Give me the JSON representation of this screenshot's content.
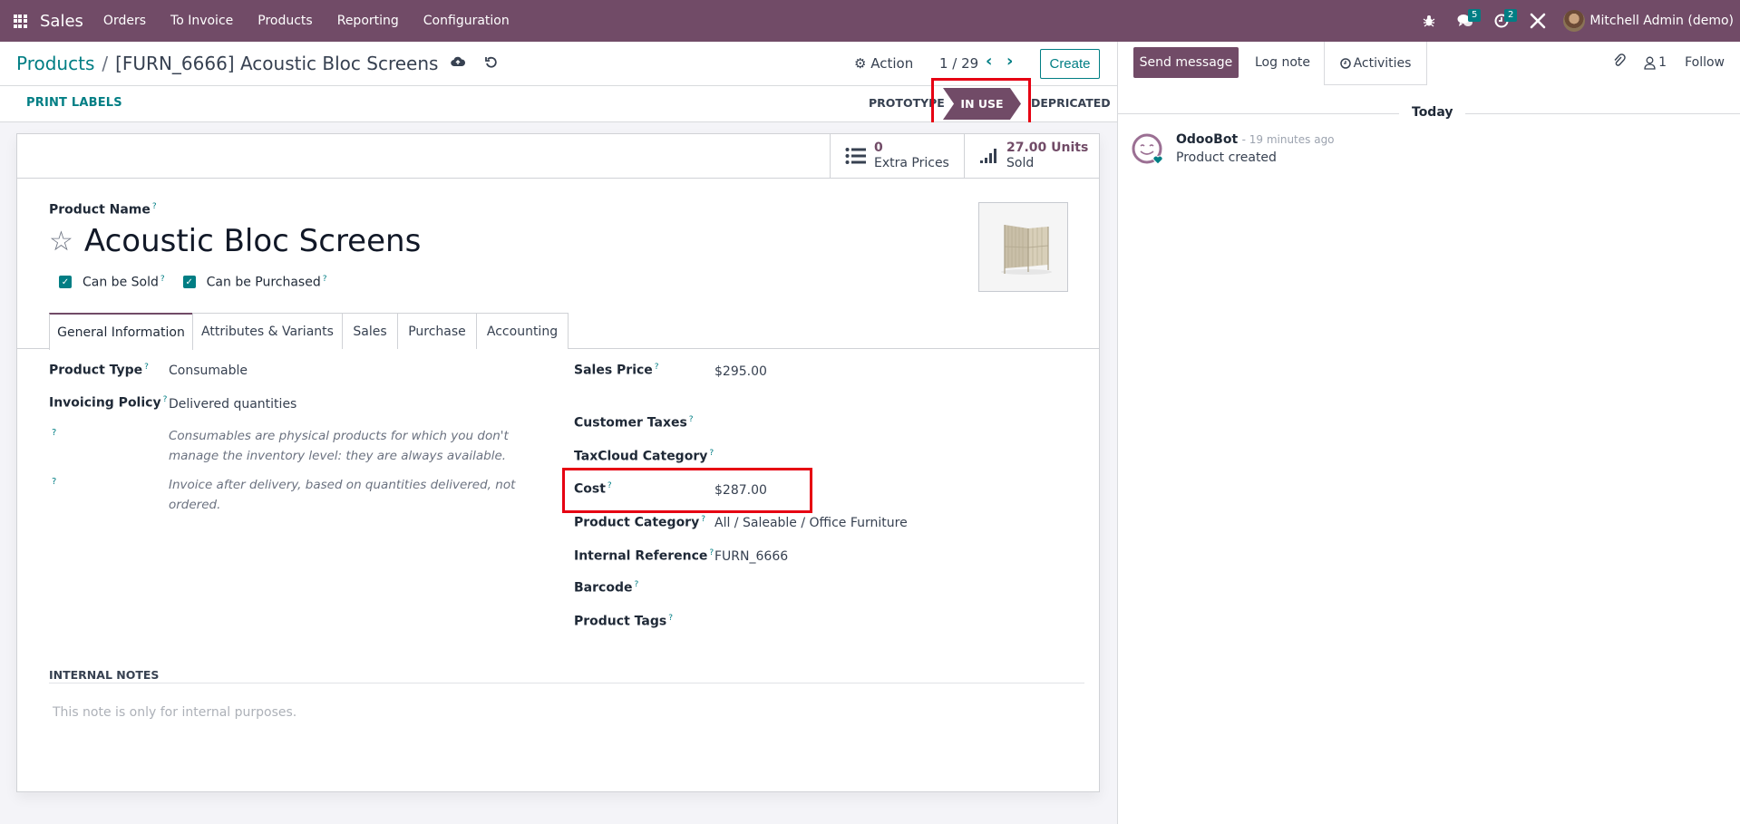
{
  "navbar": {
    "app_name": "Sales",
    "menu": [
      "Orders",
      "To Invoice",
      "Products",
      "Reporting",
      "Configuration"
    ],
    "messages_count": "5",
    "activities_count": "2",
    "user_name": "Mitchell Admin (demo)",
    "icons": [
      "apps-grid-icon",
      "bug-icon",
      "chat-icon",
      "clock-icon",
      "tools-icon"
    ]
  },
  "control_panel": {
    "breadcrumb_root": "Products",
    "breadcrumb_separator": "/",
    "breadcrumb_current": "[FURN_6666] Acoustic Bloc Screens",
    "action_label": "Action",
    "pager": "1 / 29",
    "create_label": "Create"
  },
  "status_bar": {
    "print_labels": "PRINT LABELS",
    "stages": [
      "PROTOTYPE",
      "IN USE",
      "DEPRICATED"
    ],
    "active_stage": "IN USE"
  },
  "smart_buttons": [
    {
      "value": "0",
      "label": "Extra Prices",
      "icon": "list-icon"
    },
    {
      "value": "27.00 Units",
      "label": "Sold",
      "icon": "signal-bars-icon"
    }
  ],
  "product": {
    "name_label": "Product Name",
    "name": "Acoustic Bloc Screens",
    "can_be_sold_label": "Can be Sold",
    "can_be_sold": true,
    "can_be_purchased_label": "Can be Purchased",
    "can_be_purchased": true
  },
  "tabs": [
    "General Information",
    "Attributes & Variants",
    "Sales",
    "Purchase",
    "Accounting"
  ],
  "active_tab": "General Information",
  "general_left": {
    "product_type_label": "Product Type",
    "product_type": "Consumable",
    "invoicing_policy_label": "Invoicing Policy",
    "invoicing_policy": "Delivered quantities",
    "help_type": "Consumables are physical products for which you don't manage the inventory level: they are always available.",
    "help_invoice": "Invoice after delivery, based on quantities delivered, not ordered."
  },
  "general_right": {
    "sales_price_label": "Sales Price",
    "sales_price": "$295.00",
    "customer_taxes_label": "Customer Taxes",
    "customer_taxes": "",
    "taxcloud_label": "TaxCloud Category",
    "taxcloud": "",
    "cost_label": "Cost",
    "cost": "$287.00",
    "category_label": "Product Category",
    "category": "All / Saleable / Office Furniture",
    "internal_ref_label": "Internal Reference",
    "internal_ref": "FURN_6666",
    "barcode_label": "Barcode",
    "barcode": "",
    "tags_label": "Product Tags",
    "tags": ""
  },
  "internal_notes": {
    "title": "INTERNAL NOTES",
    "placeholder": "This note is only for internal purposes."
  },
  "chatter": {
    "send_message": "Send message",
    "log_note": "Log note",
    "activities": "Activities",
    "followers_count": "1",
    "follow": "Follow",
    "date_separator": "Today",
    "messages": [
      {
        "author": "OdooBot",
        "date": "- 19 minutes ago",
        "body": "Product created"
      }
    ]
  },
  "colors": {
    "brand": "#714b67",
    "accent": "#017e84",
    "highlight": "#e60012"
  }
}
